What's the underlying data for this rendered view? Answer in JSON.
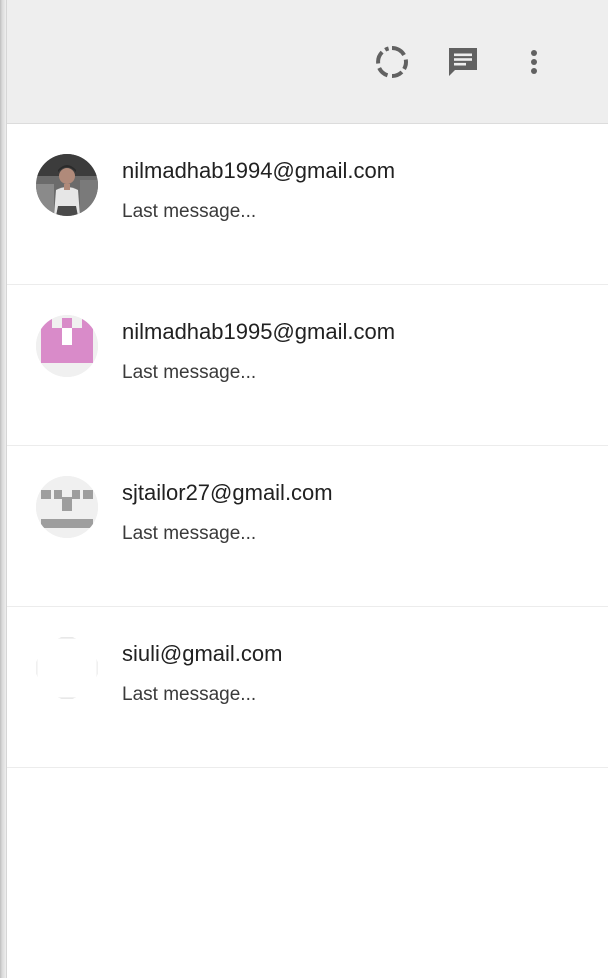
{
  "header": {
    "icons": {
      "status": "status-ring-icon",
      "chat": "new-chat-icon",
      "menu": "more-vert-icon"
    },
    "icon_color": "#616161",
    "background": "#eeeeee"
  },
  "chats": [
    {
      "title": "nilmadhab1994@gmail.com",
      "subtitle": "Last message...",
      "avatar": "photo"
    },
    {
      "title": "nilmadhab1995@gmail.com",
      "subtitle": "Last message...",
      "avatar": "identicon-pink"
    },
    {
      "title": "sjtailor27@gmail.com",
      "subtitle": "Last message...",
      "avatar": "identicon-gray"
    },
    {
      "title": "siuli@gmail.com",
      "subtitle": "Last message...",
      "avatar": "blank"
    }
  ]
}
